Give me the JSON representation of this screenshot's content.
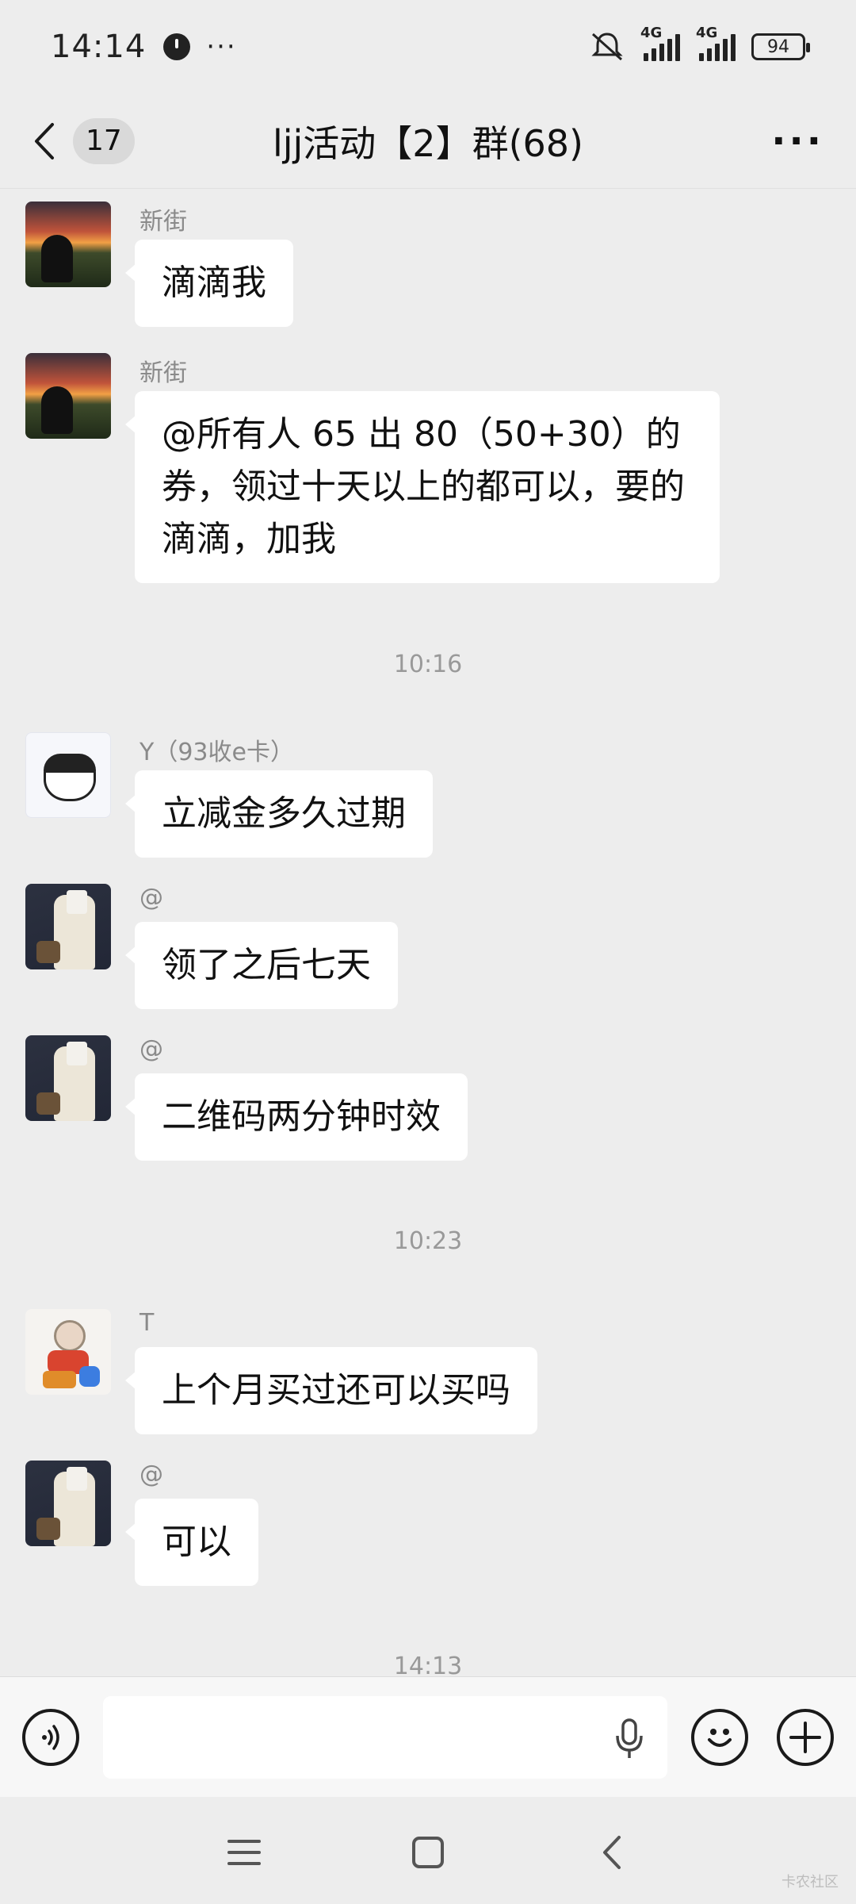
{
  "status_bar": {
    "time": "14:14",
    "more": "···",
    "network_1": "4G",
    "network_2": "4G",
    "battery": "94"
  },
  "nav": {
    "unread_count": "17",
    "title": "ljj活动【2】群(68)",
    "more": "···"
  },
  "messages": [
    {
      "sender": "新街",
      "text": "滴滴我",
      "avatar": "sunset-avatar"
    },
    {
      "sender": "新街",
      "text": "@所有人  65 出 80（50+30）的券，领过十天以上的都可以，要的滴滴，加我",
      "avatar": "sunset-avatar"
    },
    {
      "sender": "Y（93收e卡）",
      "text": "立减金多久过期",
      "avatar": "cat-avatar"
    },
    {
      "sender": "@",
      "text": "领了之后七天",
      "avatar": "dark-avatar"
    },
    {
      "sender": "@",
      "text": "二维码两分钟时效",
      "avatar": "dark-avatar"
    },
    {
      "sender": "T",
      "text": "上个月买过还可以买吗",
      "avatar": "girl-avatar"
    },
    {
      "sender": "@",
      "text": "可以",
      "avatar": "dark-avatar"
    }
  ],
  "timestamps": [
    "10:16",
    "10:23",
    "14:13"
  ],
  "input": {
    "value": "",
    "placeholder": ""
  },
  "watermark": "卡农社区",
  "colors": {
    "background": "#ededed",
    "bubble": "#ffffff",
    "sender": "#8a8a8a",
    "timestamp": "#999999"
  }
}
